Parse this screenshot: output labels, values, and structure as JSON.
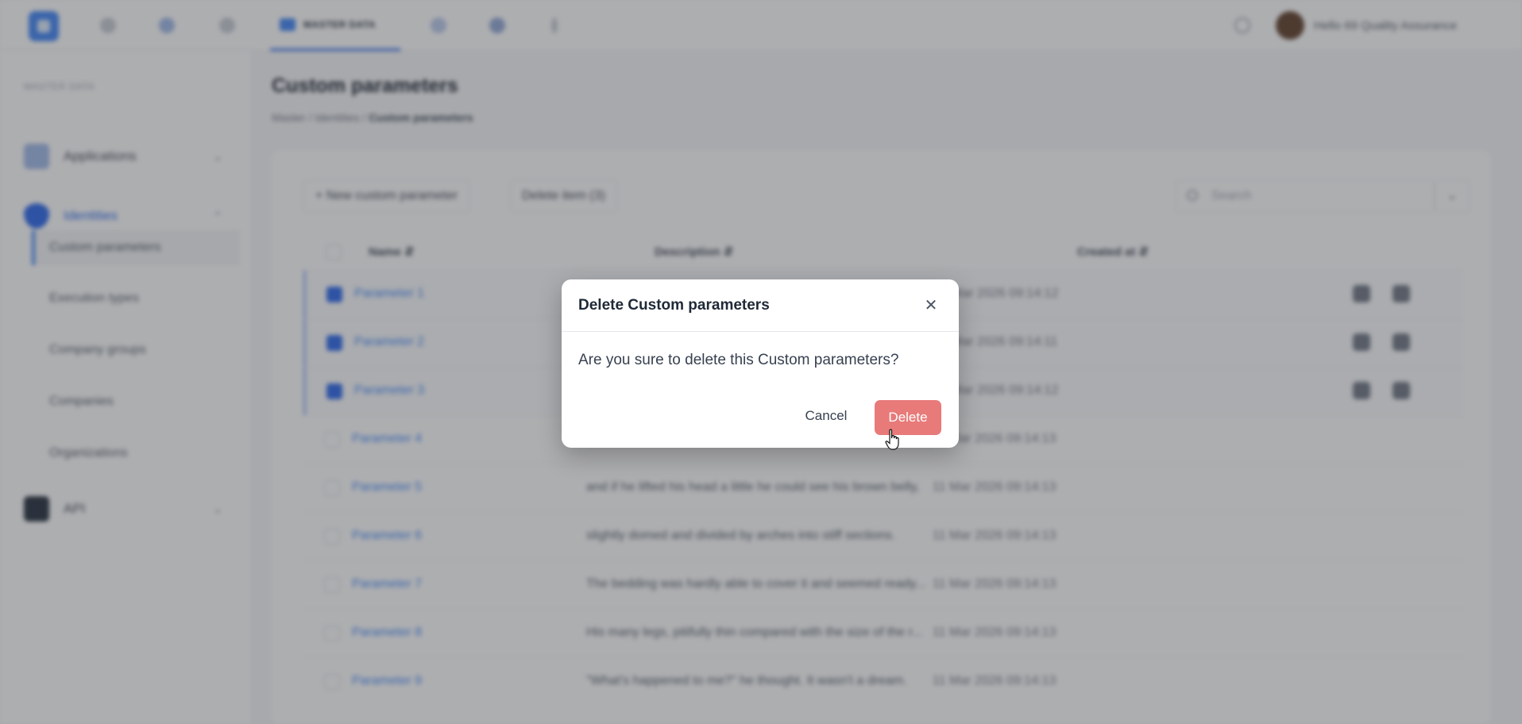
{
  "topbar": {
    "active_tab": "MASTER DATA",
    "user_name": "Hello 69 Quality Assurance",
    "icons": [
      "dashboard-icon",
      "grid-icon",
      "clock-icon",
      "chat-icon",
      "settings-icon",
      "more-vertical-icon"
    ]
  },
  "sidebar": {
    "section_title": "MASTER DATA",
    "groups": [
      {
        "label": "Applications",
        "chevron": "⌄"
      },
      {
        "label": "Identities",
        "chevron": "⌃"
      },
      {
        "label": "API",
        "chevron": "⌄"
      }
    ],
    "items": [
      "Custom parameters",
      "Execution types",
      "Company groups",
      "Companies",
      "Organizations"
    ]
  },
  "page": {
    "title": "Custom parameters",
    "breadcrumb": [
      "Master",
      "Identities",
      "Custom parameters"
    ],
    "breadcrumb_sep": "/"
  },
  "toolbar": {
    "new_label": "+ New custom parameter",
    "delete_label": "Delete item (3)",
    "search_placeholder": "Search",
    "more_label": "⌄"
  },
  "table": {
    "columns": [
      "Name",
      "Description",
      "Created at"
    ],
    "sort_glyph": "⇵",
    "rows": [
      {
        "name": "Parameter 1",
        "description": "",
        "created": "11 Mar 2026 09:14:12",
        "selected": true
      },
      {
        "name": "Parameter 2",
        "description": "",
        "created": "11 Mar 2026 09:14:11",
        "selected": true
      },
      {
        "name": "Parameter 3",
        "description": "",
        "created": "11 Mar 2026 09:14:12",
        "selected": true
      },
      {
        "name": "Parameter 4",
        "description": "",
        "created": "11 Mar 2026 09:14:13",
        "selected": false
      },
      {
        "name": "Parameter 5",
        "description": "and if he lifted his head a little he could see his brown belly,",
        "created": "11 Mar 2026 09:14:13",
        "selected": false
      },
      {
        "name": "Parameter 6",
        "description": "slightly domed and divided by arches into stiff sections.",
        "created": "11 Mar 2026 09:14:13",
        "selected": false
      },
      {
        "name": "Parameter 7",
        "description": "The bedding was hardly able to cover it and seemed ready...",
        "created": "11 Mar 2026 09:14:13",
        "selected": false
      },
      {
        "name": "Parameter 8",
        "description": "His many legs, pitifully thin compared with the size of the r...",
        "created": "11 Mar 2026 09:14:13",
        "selected": false
      },
      {
        "name": "Parameter 9",
        "description": "\"What's happened to me?\" he thought. It wasn't a dream.",
        "created": "11 Mar 2026 09:14:13",
        "selected": false
      }
    ]
  },
  "dialog": {
    "title": "Delete Custom parameters",
    "close_glyph": "✕",
    "message": "Are you sure to delete this Custom parameters?",
    "cancel_label": "Cancel",
    "delete_label": "Delete",
    "delete_color": "#e87a7a"
  }
}
